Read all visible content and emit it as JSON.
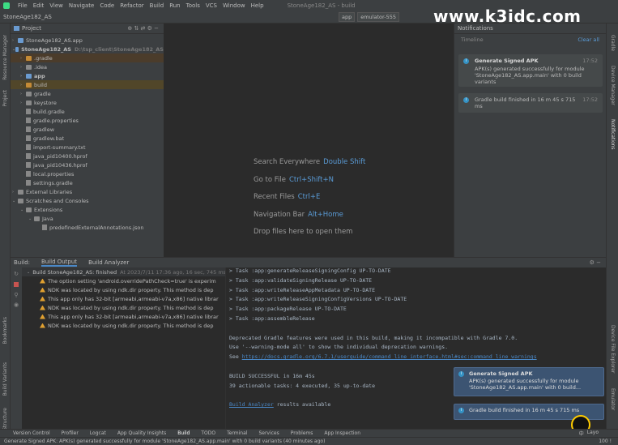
{
  "menubar": {
    "items": [
      "File",
      "Edit",
      "View",
      "Navigate",
      "Code",
      "Refactor",
      "Build",
      "Run",
      "Tools",
      "VCS",
      "Window",
      "Help"
    ],
    "window_title": "StoneAge182_AS - build"
  },
  "navbar": {
    "breadcrumb": "StoneAge182_AS",
    "run_config": "app",
    "device": "emulator-555"
  },
  "watermark": "www.k3idc.com",
  "left_strip": {
    "resource_manager": "Resource Manager",
    "project": "Project",
    "bookmarks": "Bookmarks",
    "build_variants": "Build Variants",
    "structure": "Structure"
  },
  "project": {
    "title": "Project",
    "rows": [
      {
        "label": "StoneAge182_AS.app",
        "dim": ""
      },
      {
        "label": "StoneAge182_AS",
        "dim": "D:\\tsp_client\\StoneAge182_AS"
      },
      {
        "label": ".gradle",
        "dim": ""
      },
      {
        "label": ".idea",
        "dim": ""
      },
      {
        "label": "app",
        "dim": ""
      },
      {
        "label": "build",
        "dim": ""
      },
      {
        "label": "gradle",
        "dim": ""
      },
      {
        "label": "keystore",
        "dim": ""
      },
      {
        "label": "build.gradle",
        "dim": ""
      },
      {
        "label": "gradle.properties",
        "dim": ""
      },
      {
        "label": "gradlew",
        "dim": ""
      },
      {
        "label": "gradlew.bat",
        "dim": ""
      },
      {
        "label": "import-summary.txt",
        "dim": ""
      },
      {
        "label": "java_pid10400.hprof",
        "dim": ""
      },
      {
        "label": "java_pid10436.hprof",
        "dim": ""
      },
      {
        "label": "local.properties",
        "dim": ""
      },
      {
        "label": "settings.gradle",
        "dim": ""
      },
      {
        "label": "External Libraries",
        "dim": ""
      },
      {
        "label": "Scratches and Consoles",
        "dim": ""
      },
      {
        "label": "Extensions",
        "dim": ""
      },
      {
        "label": "Java",
        "dim": ""
      },
      {
        "label": "predefinedExternalAnnotations.json",
        "dim": ""
      }
    ]
  },
  "editor_hints": [
    {
      "label": "Search Everywhere",
      "key": "Double Shift"
    },
    {
      "label": "Go to File",
      "key": "Ctrl+Shift+N"
    },
    {
      "label": "Recent Files",
      "key": "Ctrl+E"
    },
    {
      "label": "Navigation Bar",
      "key": "Alt+Home"
    },
    {
      "label": "Drop files here to open them",
      "key": ""
    }
  ],
  "notifications": {
    "title": "Notifications",
    "timeline": "Timeline",
    "clear_all": "Clear all",
    "cards": [
      {
        "title": "Generate Signed APK",
        "time": "17:52",
        "body": "APK(s) generated successfully for module 'StoneAge182_AS.app.main' with 0 build variants"
      },
      {
        "title": "",
        "time": "17:52",
        "body": "Gradle build finished in 16 m 45 s 715 ms"
      }
    ]
  },
  "right_strip": {
    "gradle": "Gradle",
    "device_manager": "Device Manager",
    "notifications": "Notifications",
    "device_explorer": "Device File Explorer",
    "emulator": "Emulator"
  },
  "build_panel": {
    "tabs": [
      "Build:",
      "Build Output",
      "Build Analyzer"
    ],
    "tree": [
      {
        "icon": "ok",
        "text": "Build StoneAge182_AS: finished",
        "time": "At 2023/7/11 17:36 ago, 16 sec, 745 ms"
      },
      {
        "icon": "warn",
        "text": "The option setting 'android.overridePathCheck=true' is experim"
      },
      {
        "icon": "warn",
        "text": "NDK was located by using ndk.dir property. This method is dep"
      },
      {
        "icon": "warn",
        "text": "This app only has 32-bit [armeabi,armeabi-v7a,x86] native librar"
      },
      {
        "icon": "warn",
        "text": "NDK was located by using ndk.dir property. This method is dep"
      },
      {
        "icon": "warn",
        "text": "This app only has 32-bit [armeabi,armeabi-v7a,x86] native librar"
      },
      {
        "icon": "warn",
        "text": "NDK was located by using ndk.dir property. This method is dep"
      }
    ],
    "console": [
      "> Task :app:generateReleaseSigningConfig UP-TO-DATE",
      "> Task :app:validateSigningRelease UP-TO-DATE",
      "> Task :app:writeReleaseAppMetadata UP-TO-DATE",
      "> Task :app:writeReleaseSigningConfigVersions UP-TO-DATE",
      "> Task :app:packageRelease UP-TO-DATE",
      "> Task :app:assembleRelease",
      "",
      "Deprecated Gradle features were used in this build, making it incompatible with Gradle 7.0.",
      "Use '--warning-mode all' to show the individual deprecation warnings.",
      "See",
      "",
      "BUILD SUCCESSFUL in 16m 45s",
      "39 actionable tasks: 4 executed, 35 up-to-date",
      "",
      "results available"
    ],
    "see_link": "https://docs.gradle.org/6.7.1/userguide/command_line_interface.html#sec:command_line_warnings",
    "analyzer_link": "Build Analyzer"
  },
  "float_notifications": [
    {
      "title": "Generate Signed APK",
      "body": "APK(s) generated successfully for module 'StoneAge182_AS.app.main' with 0 build..."
    },
    {
      "title": "",
      "body": "Gradle build finished in 16 m 45 s 715 ms"
    }
  ],
  "bottom_tools": [
    "Version Control",
    "Profiler",
    "Logcat",
    "App Quality Insights",
    "Build",
    "TODO",
    "Terminal",
    "Services",
    "Problems",
    "App Inspection"
  ],
  "status": "Generate Signed APK: APK(s) generated successfully for module 'StoneAge182_AS.app.main' with 0 build variants (40 minutes ago)",
  "tray": {
    "ime": "中",
    "lang": "Layo",
    "misc": "100 !"
  }
}
